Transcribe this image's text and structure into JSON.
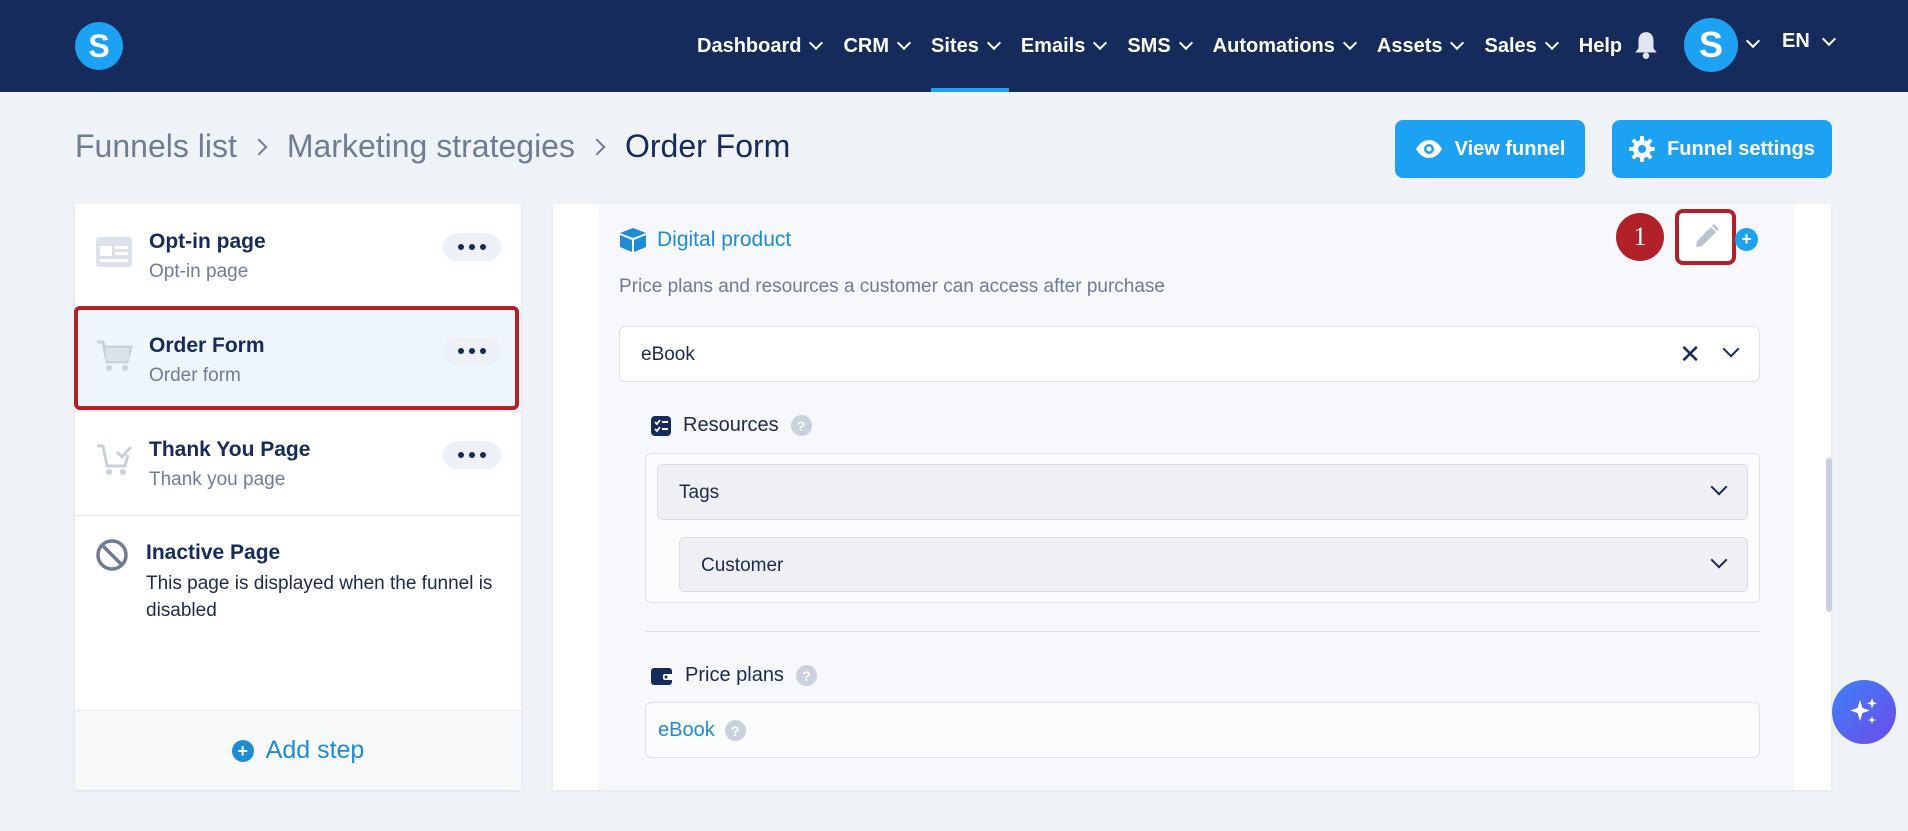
{
  "nav": {
    "items": [
      {
        "label": "Dashboard",
        "has_menu": true,
        "active": false
      },
      {
        "label": "CRM",
        "has_menu": true,
        "active": false
      },
      {
        "label": "Sites",
        "has_menu": true,
        "active": true
      },
      {
        "label": "Emails",
        "has_menu": true,
        "active": false
      },
      {
        "label": "SMS",
        "has_menu": true,
        "active": false
      },
      {
        "label": "Automations",
        "has_menu": true,
        "active": false
      },
      {
        "label": "Assets",
        "has_menu": true,
        "active": false
      },
      {
        "label": "Sales",
        "has_menu": true,
        "active": false
      },
      {
        "label": "Help",
        "has_menu": false,
        "active": false
      }
    ],
    "logo_letter": "S",
    "avatar_letter": "S",
    "language": "EN"
  },
  "breadcrumb": {
    "items": [
      "Funnels list",
      "Marketing strategies",
      "Order Form"
    ]
  },
  "actions": {
    "view_funnel": "View funnel",
    "funnel_settings": "Funnel settings"
  },
  "steps": {
    "items": [
      {
        "title": "Opt-in page",
        "subtitle": "Opt-in page",
        "icon": "opt-in-page-icon"
      },
      {
        "title": "Order Form",
        "subtitle": "Order form",
        "icon": "cart-icon",
        "selected": true
      },
      {
        "title": "Thank You Page",
        "subtitle": "Thank you page",
        "icon": "cart-check-icon"
      }
    ],
    "inactive": {
      "title": "Inactive Page",
      "description": "This page is displayed when the funnel is disabled"
    },
    "add_step": "Add step"
  },
  "product": {
    "title": "Digital product",
    "description": "Price plans and resources a customer can access after purchase",
    "selected": "eBook",
    "annotation_number": "1",
    "resources_label": "Resources",
    "resource_type": "Tags",
    "resource_value": "Customer",
    "price_plans_label": "Price plans",
    "price_plan": "eBook"
  },
  "colors": {
    "nav_bg": "#152b5c",
    "accent": "#1da1f2",
    "highlight_red": "#b2202a"
  }
}
